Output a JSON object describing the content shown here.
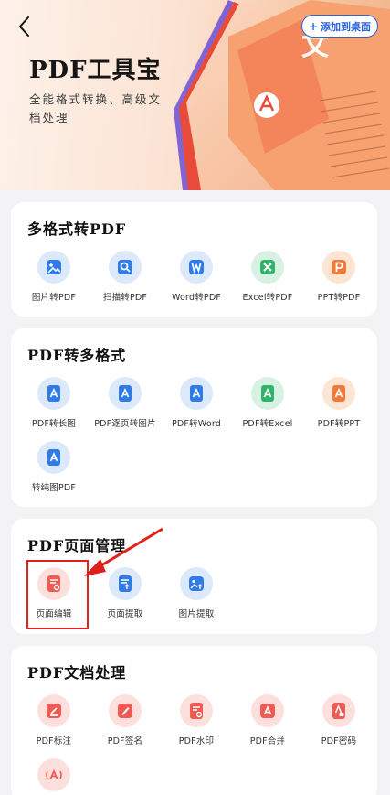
{
  "header": {
    "add_button_label": "添加到桌面",
    "title": "PDF工具宝",
    "subtitle": "全能格式转换、高级文档处理",
    "art_title_glyph": "文"
  },
  "sections": [
    {
      "title": "多格式转PDF",
      "tools": [
        {
          "label": "图片转PDF",
          "icon": "image-icon"
        },
        {
          "label": "扫描转PDF",
          "icon": "scan-icon"
        },
        {
          "label": "Word转PDF",
          "icon": "word-icon"
        },
        {
          "label": "Excel转PDF",
          "icon": "excel-icon"
        },
        {
          "label": "PPT转PDF",
          "icon": "ppt-icon"
        }
      ]
    },
    {
      "title": "PDF转多格式",
      "tools": [
        {
          "label": "PDF转长图",
          "icon": "pdf-image-icon"
        },
        {
          "label": "PDF逐页转图片",
          "icon": "pdf-pages-icon"
        },
        {
          "label": "PDF转Word",
          "icon": "pdf-word-icon"
        },
        {
          "label": "PDF转Excel",
          "icon": "pdf-excel-icon"
        },
        {
          "label": "PDF转PPT",
          "icon": "pdf-ppt-icon"
        },
        {
          "label": "转纯图PDF",
          "icon": "pdf-pure-image-icon"
        }
      ]
    },
    {
      "title": "PDF页面管理",
      "tools": [
        {
          "label": "页面编辑",
          "icon": "page-edit-icon"
        },
        {
          "label": "页面提取",
          "icon": "page-extract-icon"
        },
        {
          "label": "图片提取",
          "icon": "image-extract-icon"
        }
      ]
    },
    {
      "title": "PDF文档处理",
      "tools": [
        {
          "label": "PDF标注",
          "icon": "annotate-icon"
        },
        {
          "label": "PDF签名",
          "icon": "sign-icon"
        },
        {
          "label": "PDF水印",
          "icon": "watermark-icon"
        },
        {
          "label": "PDF合并",
          "icon": "merge-icon"
        },
        {
          "label": "PDF密码",
          "icon": "password-icon"
        }
      ]
    }
  ],
  "colors": {
    "accent_blue": "#2b63d9",
    "highlight_red": "#e0201c",
    "pdf_orange": "#f07a3a",
    "tool_red": "#ef5a52",
    "tool_green": "#31b36b"
  }
}
